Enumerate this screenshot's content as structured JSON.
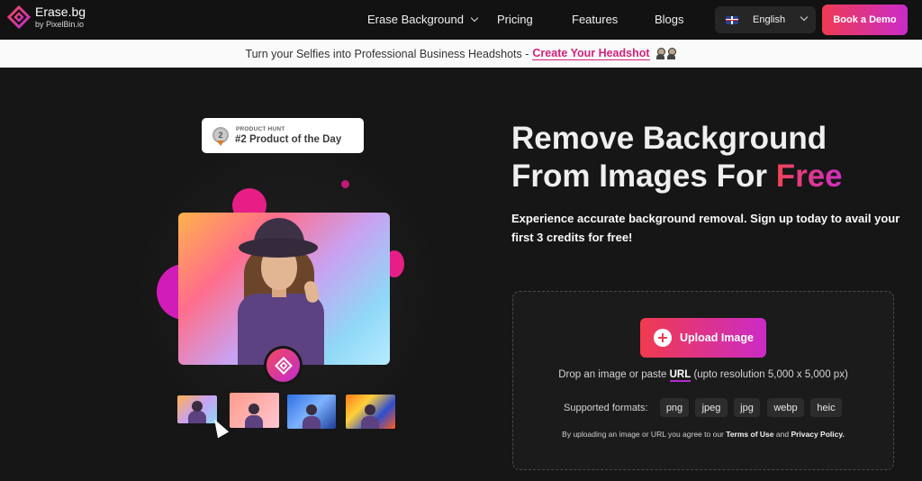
{
  "header": {
    "logo": {
      "name": "Erase.bg",
      "sub": "by PixelBin.io"
    },
    "nav": [
      {
        "label": "Erase Background",
        "has_dropdown": true
      },
      {
        "label": "Pricing"
      },
      {
        "label": "Features"
      },
      {
        "label": "Blogs"
      }
    ],
    "language": {
      "label": "English",
      "flag_icon": "uk-flag-icon"
    },
    "cta": "Book a Demo"
  },
  "announcement": {
    "text": "Turn your Selfies into Professional Business Headshots -",
    "link": "Create Your Headshot"
  },
  "badge": {
    "small": "PRODUCT HUNT",
    "main": "#2 Product of the Day",
    "medal_number": "2"
  },
  "hero": {
    "title_line1": "Remove Background",
    "title_line2": "From Images For",
    "title_highlight": "Free",
    "subtitle": "Experience accurate background removal. Sign up today to avail your first 3 credits for free!"
  },
  "upload": {
    "button": "Upload Image",
    "drop_text_before": "Drop an image or paste",
    "drop_link": "URL",
    "drop_text_after": "(upto resolution 5,000 x 5,000 px)",
    "formats_label": "Supported formats:",
    "formats": [
      "png",
      "jpeg",
      "jpg",
      "webp",
      "heic"
    ],
    "terms_before": "By uploading an image or URL you agree to our",
    "terms_link": "Terms of Use",
    "terms_and": "and",
    "privacy_link": "Privacy Policy."
  },
  "colors": {
    "accent_start": "#f03b4e",
    "accent_end": "#cb2bc7",
    "background": "#161616"
  }
}
